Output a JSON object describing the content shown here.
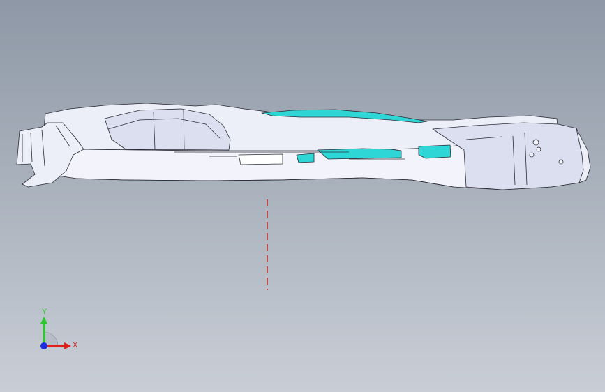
{
  "viewport": {
    "background_top": "#8e98a6",
    "background_bottom": "#c9ced6"
  },
  "model": {
    "body_color": "#f2f3fb",
    "shade_color": "#dcdff0",
    "accent_color": "#2fd6d6",
    "edge_color": "#2b2b35"
  },
  "section_plane": {
    "color": "#cc0000",
    "style": "dashed"
  },
  "triad": {
    "x_label": "X",
    "y_label": "Y",
    "x_color": "#e0201a",
    "y_color": "#2ec82e",
    "z_color": "#1a2ae0",
    "icons": [
      "x-axis-arrow-icon",
      "y-axis-arrow-icon",
      "z-axis-origin-icon"
    ]
  }
}
